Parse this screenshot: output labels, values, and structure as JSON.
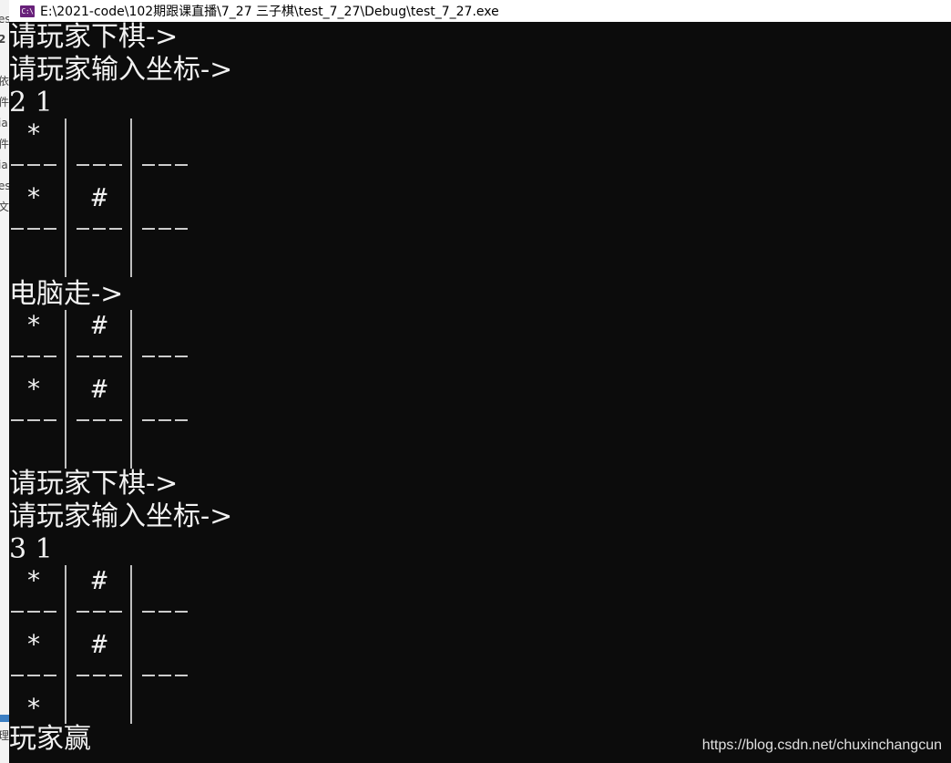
{
  "window": {
    "title": "E:\\2021-code\\102期跟课直播\\7_27 三子棋\\test_7_27\\Debug\\test_7_27.exe",
    "icon": "c-sharp-console-icon"
  },
  "left_strip": {
    "fragments": [
      "es",
      "2",
      "依",
      "件",
      "ia",
      "件",
      "ia",
      "es",
      "文",
      "理"
    ]
  },
  "console": {
    "lines": [
      "请玩家下棋->",
      "请玩家输入坐标->",
      "2 1",
      "电脑走->",
      "请玩家下棋->",
      "请玩家输入坐标->",
      "3 1",
      "玩家赢"
    ],
    "boards": [
      {
        "cells": [
          [
            "*",
            "",
            ""
          ],
          [
            "*",
            "#",
            ""
          ],
          [
            "",
            "",
            ""
          ]
        ]
      },
      {
        "cells": [
          [
            "*",
            "#",
            ""
          ],
          [
            "*",
            "#",
            ""
          ],
          [
            "",
            "",
            ""
          ]
        ]
      },
      {
        "cells": [
          [
            "*",
            "#",
            ""
          ],
          [
            "*",
            "#",
            ""
          ],
          [
            "*",
            "",
            ""
          ]
        ]
      }
    ]
  },
  "watermark": "https://blog.csdn.net/chuxinchangcun",
  "colors": {
    "console_bg": "#0c0c0c",
    "console_fg": "#f2f2f2",
    "title_bg": "#ffffff"
  }
}
